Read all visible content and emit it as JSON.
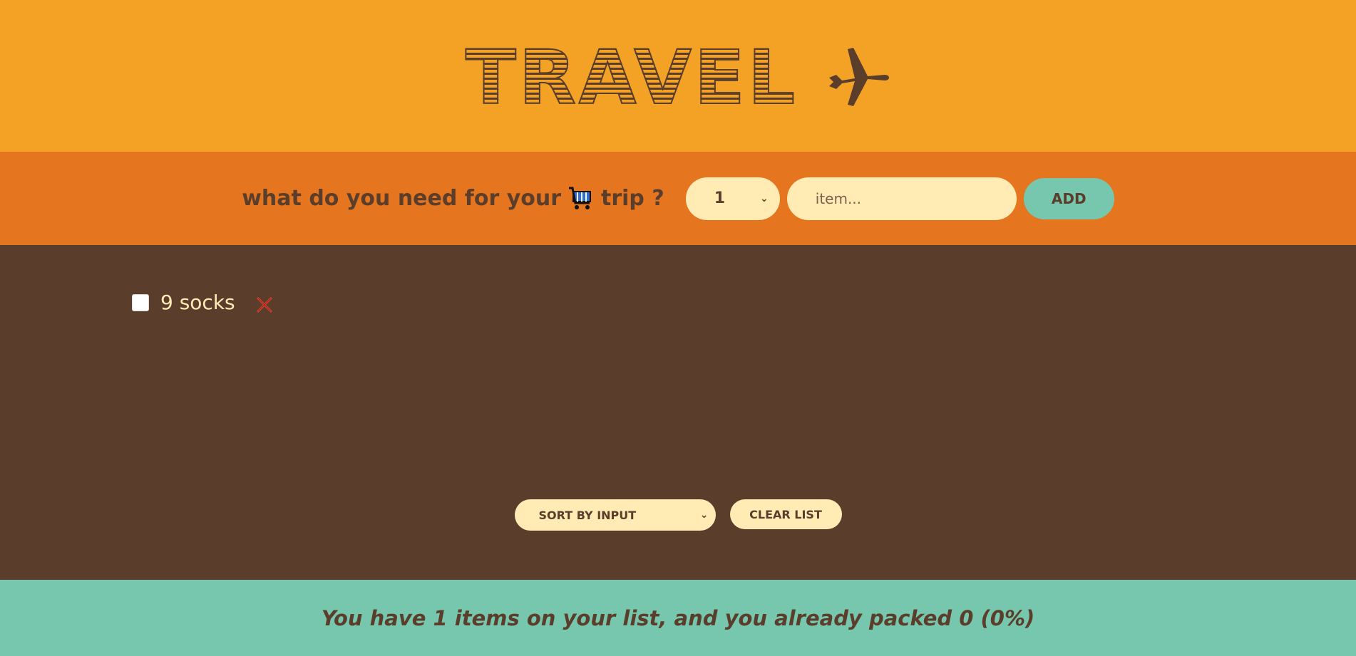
{
  "header": {
    "logo_text": "TRAVEL",
    "icon": "airplane-icon"
  },
  "form": {
    "question_before": "what do you need for your",
    "question_icon": "shopping-cart-icon",
    "question_after": "trip ?",
    "quantity_selected": "1",
    "item_placeholder": "item...",
    "add_label": "ADD"
  },
  "list": {
    "items": [
      {
        "label": "9 socks",
        "packed": false,
        "delete_icon": "close-icon"
      }
    ]
  },
  "actions": {
    "sort_selected": "SORT BY INPUT",
    "clear_label": "CLEAR LIST"
  },
  "stats": {
    "text": "You have 1 items on your list, and you already packed 0 (0%)"
  },
  "colors": {
    "header_bg": "#f4a226",
    "form_bg": "#e5761f",
    "list_bg": "#5a3e2b",
    "stats_bg": "#76c7ad",
    "cream": "#ffebb3",
    "brown": "#5a3e2b",
    "delete_red": "#e5412d"
  }
}
